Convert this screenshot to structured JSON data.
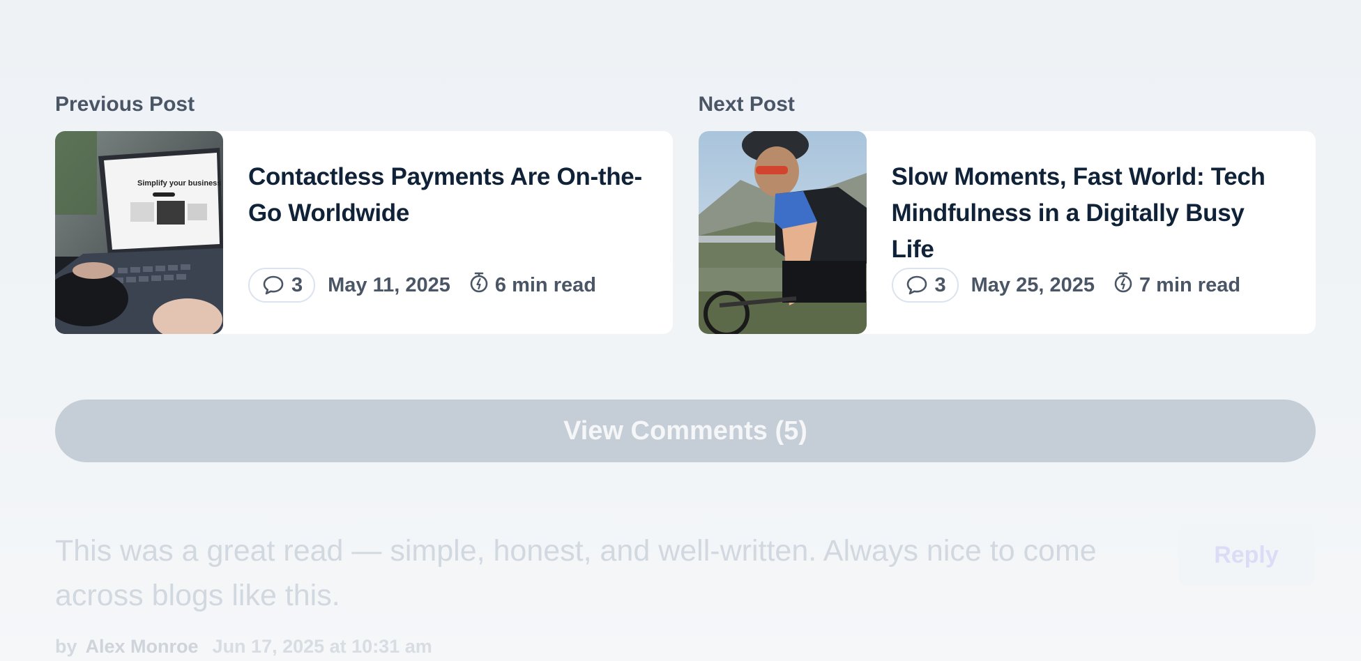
{
  "previous": {
    "heading": "Previous Post",
    "title": "Contactless Payments Are On-the-Go Worldwide",
    "comments": "3",
    "date": "May 11, 2025",
    "read_time": "6 min read"
  },
  "next": {
    "heading": "Next Post",
    "title": "Slow Moments, Fast World: Tech Mindfulness in a Digitally Busy Life",
    "comments": "3",
    "date": "May 25, 2025",
    "read_time": "7 min read"
  },
  "view_comments_label": "View Comments (5)",
  "comment": {
    "text": "This was a great read — simple, honest, and well-written. Always nice to come across blogs like this.",
    "by": "by",
    "author": "Alex Monroe",
    "timestamp": "Jun 17, 2025 at 10:31 am",
    "reply_label": "Reply"
  },
  "thumb_prev": {
    "screen_text": "Simplify your business"
  },
  "icons": [
    "comment-bubble-icon",
    "stopwatch-icon"
  ],
  "colors": {
    "title": "#0f2238",
    "meta": "#4a5566",
    "button_bg": "#c5ced7"
  }
}
